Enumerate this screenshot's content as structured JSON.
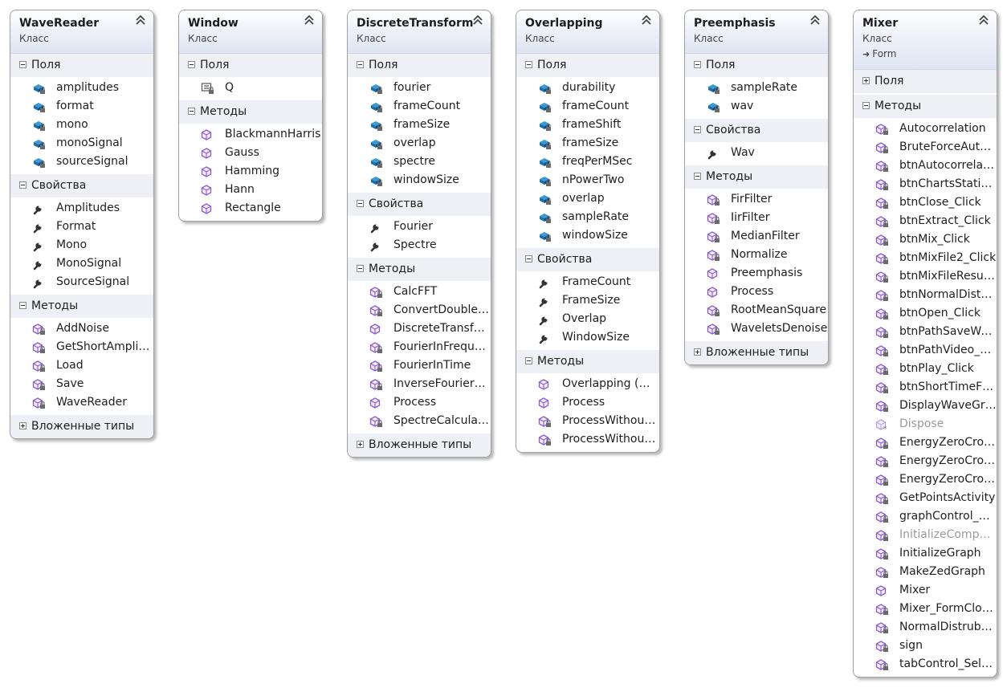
{
  "labels": {
    "fields": "Поля",
    "properties": "Свойства",
    "methods": "Методы",
    "nested": "Вложенные типы"
  },
  "classes": [
    {
      "name": "WaveReader",
      "kind": "Класс",
      "fields": [
        "amplitudes",
        "format",
        "mono",
        "monoSignal",
        "sourceSignal"
      ],
      "properties": [
        "Amplitudes",
        "Format",
        "Mono",
        "MonoSignal",
        "SourceSignal"
      ],
      "methods": [
        "AddNoise",
        "GetShortAmplit…",
        "Load",
        "Save",
        "WaveReader"
      ]
    },
    {
      "name": "Window",
      "kind": "Класс",
      "fields": [
        "Q"
      ],
      "methods": [
        "BlackmannHarris",
        "Gauss",
        "Hamming",
        "Hann",
        "Rectangle"
      ]
    },
    {
      "name": "DiscreteTransform",
      "kind": "Класс",
      "fields": [
        "fourier",
        "frameCount",
        "frameSize",
        "overlap",
        "spectre",
        "windowSize"
      ],
      "properties": [
        "Fourier",
        "Spectre"
      ],
      "methods": [
        "CalcFFT",
        "ConvertDouble…",
        "DiscreteTransfo…",
        "FourierInFrequ…",
        "FourierInTime",
        "InverseFourierT…",
        "Process",
        "SpectreCalculat…"
      ]
    },
    {
      "name": "Overlapping",
      "kind": "Класс",
      "fields": [
        "durability",
        "frameCount",
        "frameShift",
        "frameSize",
        "freqPerMSec",
        "nPowerTwo",
        "overlap",
        "sampleRate",
        "windowSize"
      ],
      "properties": [
        "FrameCount",
        "FrameSize",
        "Overlap",
        "WindowSize"
      ],
      "methods": [
        "Overlapping (+…",
        "Process",
        "ProcessWithout…",
        "ProcessWithout…"
      ]
    },
    {
      "name": "Preemphasis",
      "kind": "Класс",
      "fields": [
        "sampleRate",
        "wav"
      ],
      "properties": [
        "Wav"
      ],
      "methods": [
        "FirFilter",
        "IirFilter",
        "MedianFilter",
        "Normalize",
        "Preemphasis",
        "Process",
        "RootMeanSquare",
        "WaveletsDenoise"
      ]
    },
    {
      "name": "Mixer",
      "kind": "Класс",
      "base": "Form",
      "methods": [
        "Autocorrelation",
        "BruteForceAuto…",
        "btnAutocorrela…",
        "btnChartsStatis…",
        "btnClose_Click",
        "btnExtract_Click",
        "btnMix_Click",
        "btnMixFile2_Click",
        "btnMixFileResul…",
        "btnNormalDistr…",
        "btnOpen_Click",
        "btnPathSaveWa…",
        "btnPathVideo_…",
        "btnPlay_Click",
        "btnShortTimeF…",
        "DisplayWaveGr…",
        "Dispose",
        "EnergyZeroCro…",
        "EnergyZeroCro…",
        "EnergyZeroCro…",
        "GetPointsActivity",
        "graphControl_…",
        "InitializeCompo…",
        "InitializeGraph",
        "MakeZedGraph",
        "Mixer",
        "Mixer_FormClo…",
        "NormalDistrub…",
        "sign",
        "tabControl_Sel…"
      ]
    }
  ],
  "colors": {
    "field_icon": "#1b6fa8",
    "method_icon": "#8a5cc9",
    "property_icon": "#333333",
    "header_bg": "#dfe5f3",
    "section_bg": "#eef0f5"
  }
}
